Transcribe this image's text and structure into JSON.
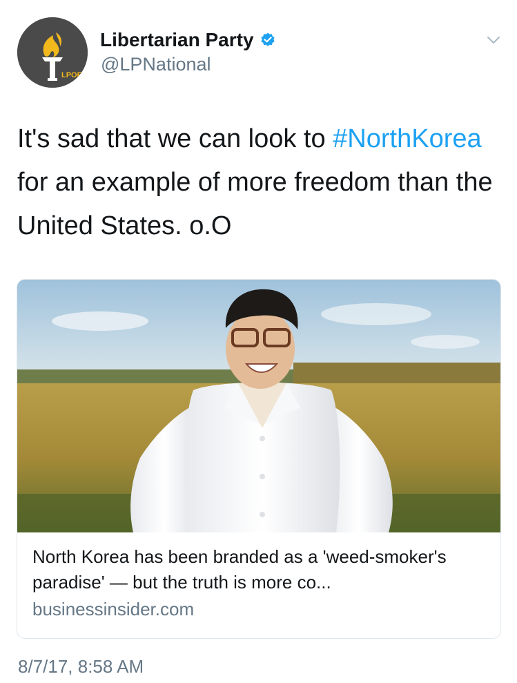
{
  "author": {
    "display_name": "Libertarian Party",
    "handle": "@LPNational",
    "verified": true,
    "avatar_logo_text": "LPORG",
    "avatar_bg": "#4a4a4a",
    "avatar_accent": "#f2b81c"
  },
  "tweet": {
    "text_before": "It's sad that we can look to ",
    "hashtag": "#NorthKorea",
    "text_after": " for an example of more freedom than the United States. o.O",
    "timestamp": "8/7/17, 8:58 AM"
  },
  "card": {
    "title": "North Korea has been branded as a 'weed-smoker's paradise' — but the truth is more co...",
    "domain": "businessinsider.com",
    "image_description_icon": "photo-man-in-white-shirt-in-field"
  },
  "icons": {
    "verified": "verified-badge-icon",
    "caret": "chevron-down-icon"
  },
  "colors": {
    "link": "#1da1f2",
    "secondary_text": "#657786",
    "primary_text": "#14171a",
    "card_border": "#e1e8ed"
  }
}
